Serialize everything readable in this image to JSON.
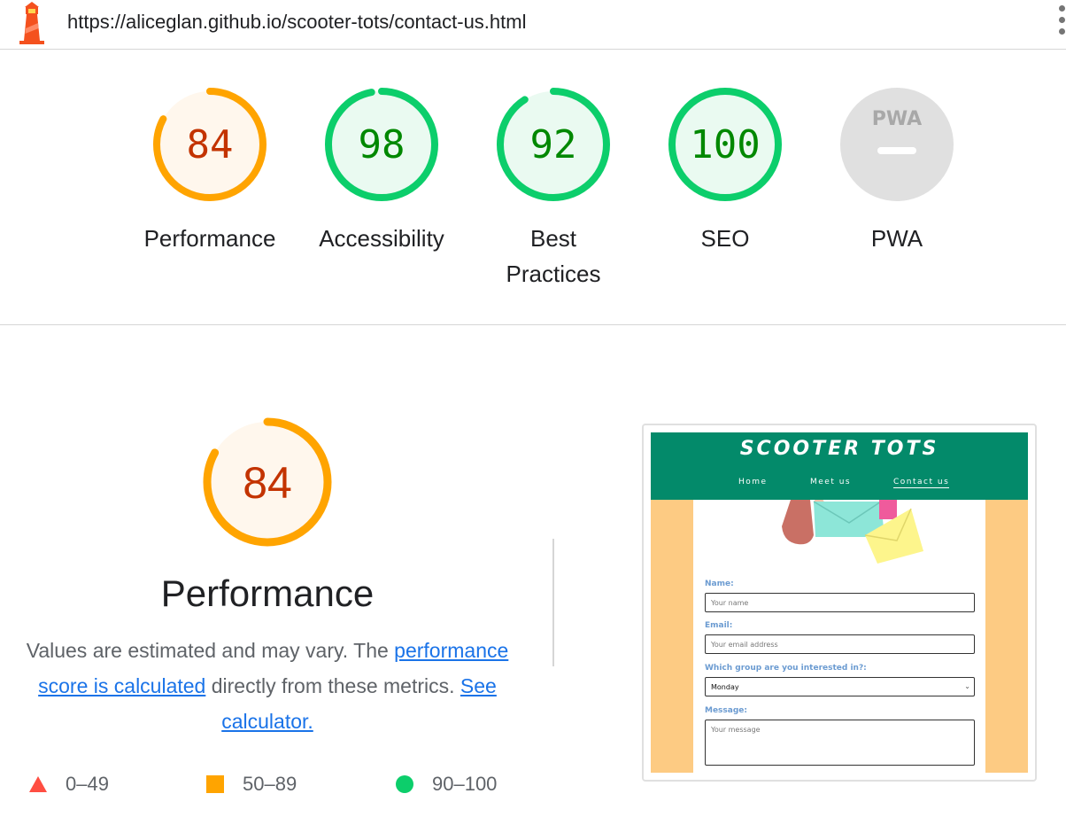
{
  "address_bar": {
    "url": "https://aliceglan.github.io/scooter-tots/contact-us.html"
  },
  "gauges": [
    {
      "id": "performance",
      "score": "84",
      "label": "Performance",
      "fraction": 0.84,
      "color": "#ffa400",
      "fill": "#fff7ed",
      "text_color": "#c33300"
    },
    {
      "id": "accessibility",
      "score": "98",
      "label": "Accessibility",
      "fraction": 0.98,
      "color": "#0cce6b",
      "fill": "#eafaf1",
      "text_color": "#008800"
    },
    {
      "id": "best-practices",
      "score": "92",
      "label": "Best Practices",
      "fraction": 0.92,
      "color": "#0cce6b",
      "fill": "#eafaf1",
      "text_color": "#008800"
    },
    {
      "id": "seo",
      "score": "100",
      "label": "SEO",
      "fraction": 1.0,
      "color": "#0cce6b",
      "fill": "#eafaf1",
      "text_color": "#008800"
    },
    {
      "id": "pwa",
      "badge": "PWA",
      "label": "PWA",
      "color": "#e0e0e0"
    }
  ],
  "performance": {
    "score": "84",
    "fraction": 0.84,
    "title": "Performance",
    "desc_pre": "Values are estimated and may vary. The ",
    "desc_link": "performance score is calculated",
    "desc_mid": " directly from these metrics. ",
    "calc_link": "See calculator."
  },
  "legend": [
    {
      "shape": "triangle",
      "range": "0–49",
      "color": "#ff4e42"
    },
    {
      "shape": "square",
      "range": "50–89",
      "color": "#ffa400"
    },
    {
      "shape": "circle",
      "range": "90–100",
      "color": "#0cce6b"
    }
  ],
  "screenshot": {
    "brand": "SCOOTER TOTS",
    "nav": [
      "Home",
      "Meet us",
      "Contact us"
    ],
    "fields": [
      {
        "label": "Name:",
        "placeholder": "Your name"
      },
      {
        "label": "Email:",
        "placeholder": "Your email address"
      },
      {
        "label": "Which group are you interested in?:",
        "value": "Monday"
      },
      {
        "label": "Message:",
        "placeholder": "Your message"
      }
    ]
  }
}
